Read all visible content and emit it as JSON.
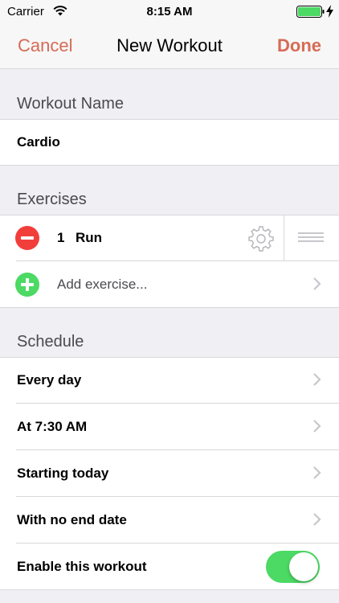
{
  "status_bar": {
    "carrier": "Carrier",
    "time": "8:15 AM"
  },
  "nav": {
    "cancel_label": "Cancel",
    "title": "New Workout",
    "done_label": "Done"
  },
  "workout_name": {
    "header": "Workout Name",
    "value": "Cardio"
  },
  "exercises": {
    "header": "Exercises",
    "items": [
      {
        "number": "1",
        "name": "Run"
      }
    ],
    "add_label": "Add exercise..."
  },
  "schedule": {
    "header": "Schedule",
    "items": [
      {
        "label": "Every day"
      },
      {
        "label": "At 7:30 AM"
      },
      {
        "label": "Starting today"
      },
      {
        "label": "With no end date"
      }
    ],
    "enable_label": "Enable this workout",
    "enabled": true
  },
  "colors": {
    "accent": "#d66b55",
    "delete": "#f23e3b",
    "add": "#4cd964",
    "toggle_on": "#4cd964"
  },
  "icons": [
    "wifi-icon",
    "battery-icon",
    "charging-bolt-icon",
    "remove-icon",
    "gear-icon",
    "reorder-handle-icon",
    "add-icon",
    "chevron-right-icon"
  ]
}
